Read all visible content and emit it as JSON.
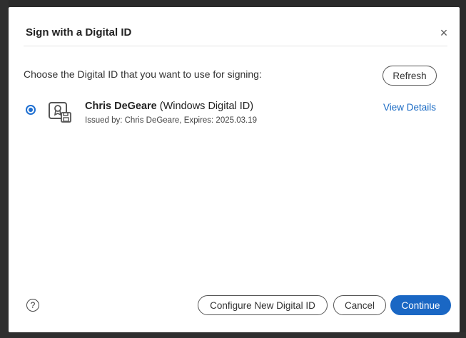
{
  "dialog": {
    "title": "Sign with a Digital ID",
    "close_icon": "close-icon",
    "prompt": "Choose the Digital ID that you want to use for signing:",
    "refresh_label": "Refresh"
  },
  "digital_id": {
    "name": "Chris DeGeare",
    "type": "(Windows Digital ID)",
    "issued_line": "Issued by: Chris DeGeare, Expires: 2025.03.19",
    "selected": true,
    "view_details_label": "View Details",
    "icon": "certificate-id-icon"
  },
  "footer": {
    "help_icon_label": "?",
    "configure_label": "Configure New Digital ID",
    "cancel_label": "Cancel",
    "continue_label": "Continue"
  },
  "colors": {
    "accent": "#1a67c4",
    "link": "#1b6bc4"
  }
}
